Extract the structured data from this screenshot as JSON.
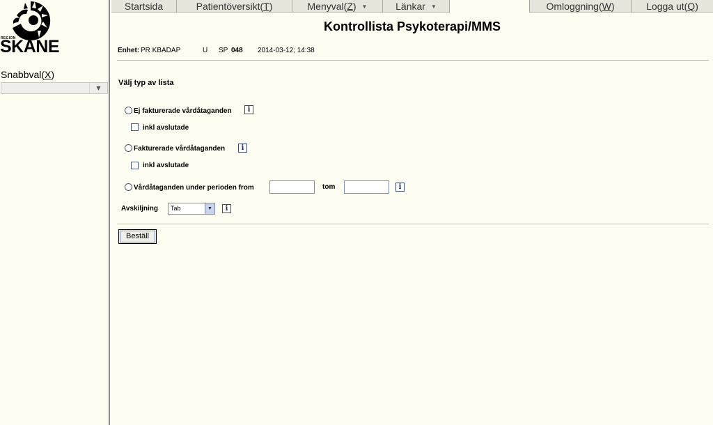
{
  "brand": {
    "region": "REGION",
    "name": "SKÅNE"
  },
  "sidebar": {
    "quick_select_label": "Snabbval(",
    "quick_select_key": "X",
    "quick_select_end": ")",
    "quick_select_value": ""
  },
  "menu": {
    "start": "Startsida",
    "patient_label": "Patientöversikt(",
    "patient_key": "T",
    "patient_end": ")",
    "menu_label": "Menyval(",
    "menu_key": "Z",
    "menu_end": ")",
    "links": "Länkar",
    "relogin_label": "Omloggning(",
    "relogin_key": "W",
    "relogin_end": ")",
    "logout_label": "Logga ut(",
    "logout_key": "Q",
    "logout_end": ")"
  },
  "page": {
    "title": "Kontrollista Psykoterapi/MMS",
    "unit_label": "Enhet:",
    "unit_value": "PR KBADAP",
    "unit_code": "U",
    "sp_label": "SP",
    "sp_value": "048",
    "datetime": "2014-03-12; 14:38"
  },
  "form": {
    "section_title": "Välj typ av lista",
    "option_unbilled": "Ej fakturerade vårdåtaganden",
    "include_closed_1": "inkl avslutade",
    "option_billed": "Fakturerade vårdåtaganden",
    "include_closed_2": "inkl avslutade",
    "option_period": "Vårdåtaganden under perioden from",
    "from_value": "",
    "to_label": "tom",
    "to_value": "",
    "separator_label": "Avskiljning",
    "separator_value": "Tab",
    "order_button": "Beställ"
  },
  "icons": {
    "info": "i",
    "dropdown": "▼"
  }
}
